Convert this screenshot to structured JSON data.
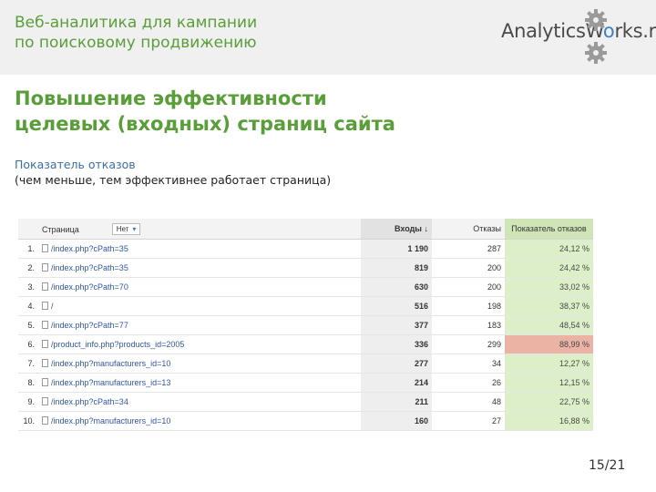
{
  "header": {
    "title_line1": "Веб-аналитика для кампании",
    "title_line2": "по поисковому продвижению",
    "logo_prefix": "AnalyticsW",
    "logo_o": "o",
    "logo_suffix": "rks.ru",
    "colors": {
      "brand_green": "#5a9e3a",
      "brand_blue": "#3b82c4",
      "header_bg": "#f0f0f0"
    }
  },
  "slide": {
    "title_line1": "Повышение эффективности",
    "title_line2": "целевых (входных) страниц сайта",
    "subtitle_line1": "Показатель отказов",
    "subtitle_line2": "(чем меньше, тем эффективнее работает страница)"
  },
  "report": {
    "columns": {
      "index": "",
      "page": "Страница",
      "filter": "Нет",
      "entrances": "Входы",
      "sort_arrow": "↓",
      "bounces": "Отказы",
      "bounce_rate": "Показатель отказов"
    },
    "rows": [
      {
        "index": "1.",
        "page": "/index.php?cPath=35",
        "entrances": "1 190",
        "bounces": "287",
        "rate": "24,12 %"
      },
      {
        "index": "2.",
        "page": "/index.php?cPath=35",
        "entrances": "819",
        "bounces": "200",
        "rate": "24,42 %"
      },
      {
        "index": "3.",
        "page": "/index.php?cPath=70",
        "entrances": "630",
        "bounces": "200",
        "rate": "33,02 %"
      },
      {
        "index": "4.",
        "page": "/",
        "entrances": "516",
        "bounces": "198",
        "rate": "38,37 %"
      },
      {
        "index": "5.",
        "page": "/index.php?cPath=77",
        "entrances": "377",
        "bounces": "183",
        "rate": "48,54 %"
      },
      {
        "index": "6.",
        "page": "/product_info.php?products_id=2005",
        "entrances": "336",
        "bounces": "299",
        "rate": "88,99 %"
      },
      {
        "index": "7.",
        "page": "/index.php?manufacturers_id=10",
        "entrances": "277",
        "bounces": "34",
        "rate": "12,27 %"
      },
      {
        "index": "8.",
        "page": "/index.php?manufacturers_id=13",
        "entrances": "214",
        "bounces": "26",
        "rate": "12,15 %"
      },
      {
        "index": "9.",
        "page": "/index.php?cPath=34",
        "entrances": "211",
        "bounces": "48",
        "rate": "22,75 %"
      },
      {
        "index": "10.",
        "page": "/index.php?manufacturers_id=10",
        "entrances": "160",
        "bounces": "27",
        "rate": "16,88 %"
      }
    ],
    "colors": {
      "good": "#dcefc8",
      "bad": "#eab3a4",
      "header_metric": "#cfe5b8"
    }
  },
  "footer": {
    "page_number": "15/21"
  }
}
